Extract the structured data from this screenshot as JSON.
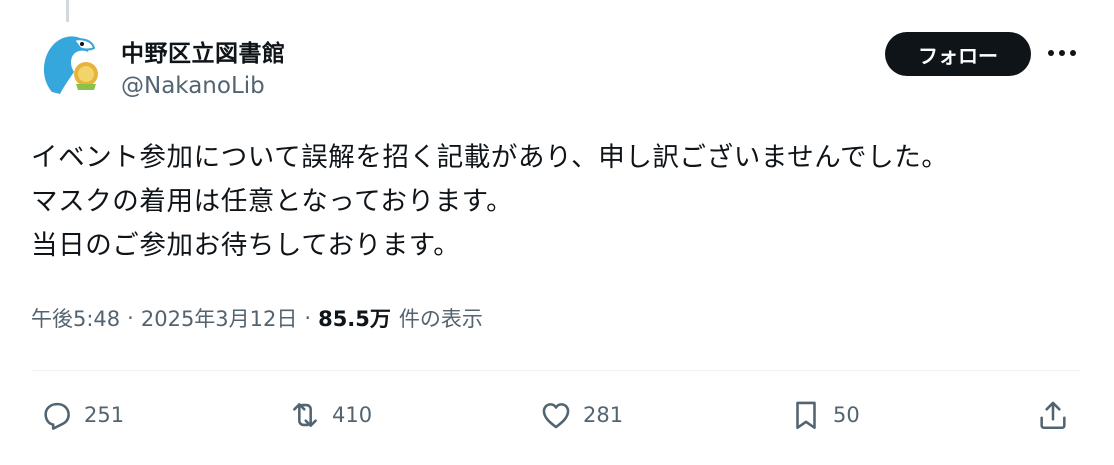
{
  "account": {
    "display_name": "中野区立図書館",
    "handle": "@NakanoLib"
  },
  "follow_label": "フォロー",
  "tweet": {
    "lines": [
      "イベント参加について誤解を招く記載があり、申し訳ございませんでした。",
      "マスクの着用は任意となっております。",
      "当日のご参加お待ちしております。"
    ]
  },
  "meta": {
    "time": "午後5:48",
    "separator": "·",
    "date": "2025年3月12日",
    "separator2": "·",
    "views": "85.5万",
    "views_label": "件の表示"
  },
  "actions": {
    "replies": "251",
    "reposts": "410",
    "likes": "281",
    "bookmarks": "50"
  },
  "icons": [
    "reply-icon",
    "repost-icon",
    "like-icon",
    "bookmark-icon",
    "share-icon",
    "more-icon"
  ],
  "colors": {
    "text": "#0f1419",
    "secondary": "#536471",
    "follow_bg": "#0f1419",
    "avatar_blue": "#35a7dc"
  }
}
